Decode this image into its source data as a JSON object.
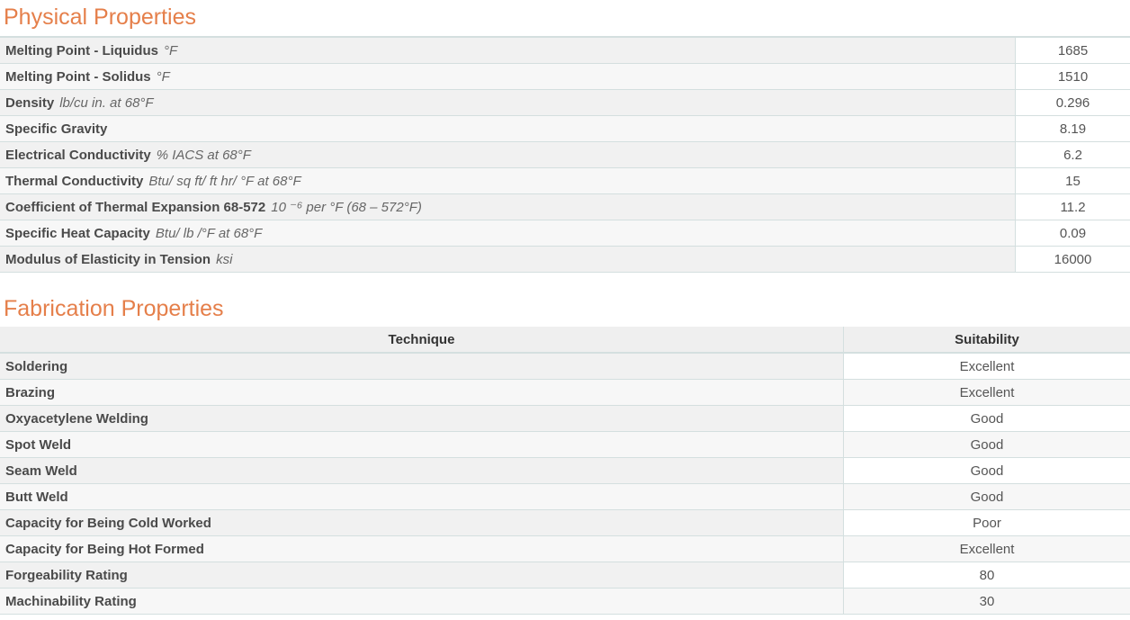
{
  "physical": {
    "title": "Physical Properties",
    "rows": [
      {
        "label": "Melting Point - Liquidus",
        "unit": "°F",
        "value": "1685"
      },
      {
        "label": "Melting Point - Solidus",
        "unit": "°F",
        "value": "1510"
      },
      {
        "label": "Density",
        "unit": "lb/cu in. at 68°F",
        "value": "0.296"
      },
      {
        "label": "Specific Gravity",
        "unit": "",
        "value": "8.19"
      },
      {
        "label": "Electrical Conductivity",
        "unit": "% IACS at 68°F",
        "value": "6.2"
      },
      {
        "label": "Thermal Conductivity",
        "unit": "Btu/ sq ft/ ft hr/ °F at 68°F",
        "value": "15"
      },
      {
        "label": "Coefficient of Thermal Expansion 68-572",
        "unit": "10 ⁻⁶ per °F (68 – 572°F)",
        "value": "11.2"
      },
      {
        "label": "Specific Heat Capacity",
        "unit": "Btu/ lb /°F at 68°F",
        "value": "0.09"
      },
      {
        "label": "Modulus of Elasticity in Tension",
        "unit": "ksi",
        "value": "16000"
      }
    ]
  },
  "fabrication": {
    "title": "Fabrication Properties",
    "header_technique": "Technique",
    "header_suitability": "Suitability",
    "rows": [
      {
        "technique": "Soldering",
        "suitability": "Excellent"
      },
      {
        "technique": "Brazing",
        "suitability": "Excellent"
      },
      {
        "technique": "Oxyacetylene Welding",
        "suitability": "Good"
      },
      {
        "technique": "Spot Weld",
        "suitability": "Good"
      },
      {
        "technique": "Seam Weld",
        "suitability": "Good"
      },
      {
        "technique": "Butt Weld",
        "suitability": "Good"
      },
      {
        "technique": "Capacity for Being Cold Worked",
        "suitability": "Poor"
      },
      {
        "technique": "Capacity for Being Hot Formed",
        "suitability": "Excellent"
      },
      {
        "technique": "Forgeability Rating",
        "suitability": "80"
      },
      {
        "technique": "Machinability Rating",
        "suitability": "30"
      }
    ]
  }
}
